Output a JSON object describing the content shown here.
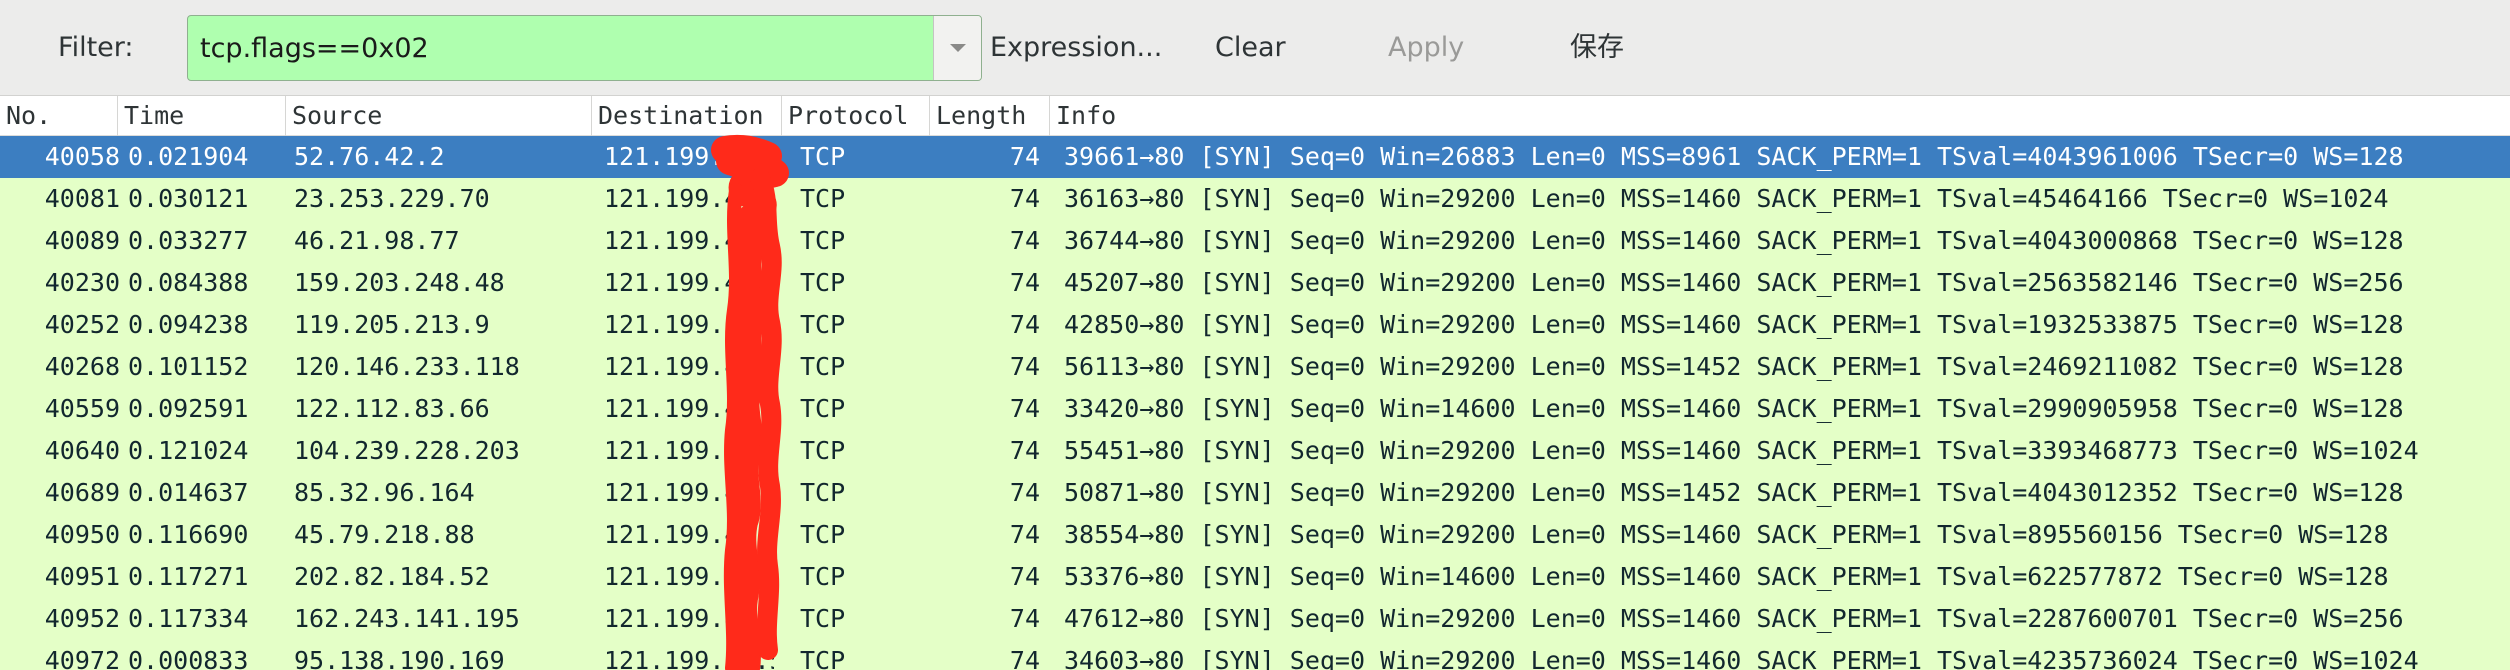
{
  "toolbar": {
    "filter_label": "Filter:",
    "filter_value": "tcp.flags==0x02",
    "expression_label": "Expression...",
    "clear_label": "Clear",
    "apply_label": "Apply",
    "save_label": "保存",
    "filter_color": "#afffaf"
  },
  "columns": {
    "no": "No.",
    "time": "Time",
    "source": "Source",
    "destination": "Destination",
    "protocol": "Protocol",
    "length": "Length",
    "info": "Info"
  },
  "colors": {
    "row_background": "#e4ffc7",
    "selected_row": "#3c7ec1",
    "redaction": "#ff2a1a"
  },
  "packets": [
    {
      "no": "40058",
      "time": "0.021904",
      "source": "52.76.42.2",
      "destination": "121.199.",
      "protocol": "TCP",
      "length": "74",
      "info": "39661→80 [SYN] Seq=0 Win=26883 Len=0 MSS=8961 SACK_PERM=1 TSval=4043961006 TSecr=0 WS=128",
      "selected": true
    },
    {
      "no": "40081",
      "time": "0.030121",
      "source": "23.253.229.70",
      "destination": "121.199.4",
      "protocol": "TCP",
      "length": "74",
      "info": "36163→80 [SYN] Seq=0 Win=29200 Len=0 MSS=1460 SACK_PERM=1 TSval=45464166 TSecr=0 WS=1024"
    },
    {
      "no": "40089",
      "time": "0.033277",
      "source": "46.21.98.77",
      "destination": "121.199.4",
      "protocol": "TCP",
      "length": "74",
      "info": "36744→80 [SYN] Seq=0 Win=29200 Len=0 MSS=1460 SACK_PERM=1 TSval=4043000868 TSecr=0 WS=128"
    },
    {
      "no": "40230",
      "time": "0.084388",
      "source": "159.203.248.48",
      "destination": "121.199.4",
      "protocol": "TCP",
      "length": "74",
      "info": "45207→80 [SYN] Seq=0 Win=29200 Len=0 MSS=1460 SACK_PERM=1 TSval=2563582146 TSecr=0 WS=256"
    },
    {
      "no": "40252",
      "time": "0.094238",
      "source": "119.205.213.9",
      "destination": "121.199.4",
      "protocol": "TCP",
      "length": "74",
      "info": "42850→80 [SYN] Seq=0 Win=29200 Len=0 MSS=1460 SACK_PERM=1 TSval=1932533875 TSecr=0 WS=128"
    },
    {
      "no": "40268",
      "time": "0.101152",
      "source": "120.146.233.118",
      "destination": "121.199.4",
      "protocol": "TCP",
      "length": "74",
      "info": "56113→80 [SYN] Seq=0 Win=29200 Len=0 MSS=1452 SACK_PERM=1 TSval=2469211082 TSecr=0 WS=128"
    },
    {
      "no": "40559",
      "time": "0.092591",
      "source": "122.112.83.66",
      "destination": "121.199.4",
      "protocol": "TCP",
      "length": "74",
      "info": "33420→80 [SYN] Seq=0 Win=14600 Len=0 MSS=1460 SACK_PERM=1 TSval=2990905958 TSecr=0 WS=128"
    },
    {
      "no": "40640",
      "time": "0.121024",
      "source": "104.239.228.203",
      "destination": "121.199.4",
      "protocol": "TCP",
      "length": "74",
      "info": "55451→80 [SYN] Seq=0 Win=29200 Len=0 MSS=1460 SACK_PERM=1 TSval=3393468773 TSecr=0 WS=1024"
    },
    {
      "no": "40689",
      "time": "0.014637",
      "source": "85.32.96.164",
      "destination": "121.199.4",
      "protocol": "TCP",
      "length": "74",
      "info": "50871→80 [SYN] Seq=0 Win=29200 Len=0 MSS=1452 SACK_PERM=1 TSval=4043012352 TSecr=0 WS=128"
    },
    {
      "no": "40950",
      "time": "0.116690",
      "source": "45.79.218.88",
      "destination": "121.199.4",
      "protocol": "TCP",
      "length": "74",
      "info": "38554→80 [SYN] Seq=0 Win=29200 Len=0 MSS=1460 SACK_PERM=1 TSval=895560156 TSecr=0 WS=128"
    },
    {
      "no": "40951",
      "time": "0.117271",
      "source": "202.82.184.52",
      "destination": "121.199.4",
      "protocol": "TCP",
      "length": "74",
      "info": "53376→80 [SYN] Seq=0 Win=14600 Len=0 MSS=1460 SACK_PERM=1 TSval=622577872 TSecr=0 WS=128"
    },
    {
      "no": "40952",
      "time": "0.117334",
      "source": "162.243.141.195",
      "destination": "121.199.4",
      "protocol": "TCP",
      "length": "74",
      "info": "47612→80 [SYN] Seq=0 Win=29200 Len=0 MSS=1460 SACK_PERM=1 TSval=2287600701 TSecr=0 WS=256"
    },
    {
      "no": "40972",
      "time": "0.000833",
      "source": "95.138.190.169",
      "destination": "121.199.4 .57",
      "protocol": "TCP",
      "length": "74",
      "info": "34603→80 [SYN] Seq=0 Win=29200 Len=0 MSS=1460 SACK_PERM=1 TSval=4235736024 TSecr=0 WS=1024"
    }
  ]
}
